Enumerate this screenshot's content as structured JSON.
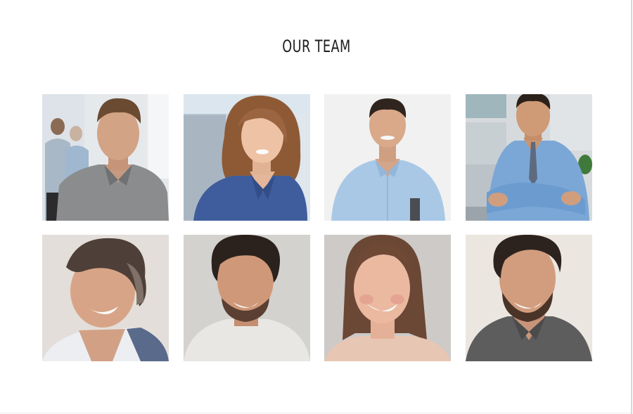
{
  "section": {
    "title": "OUR TEAM"
  },
  "team": [
    {
      "photo": "man-grey-shirt-office-photo",
      "bg": "#e7eaee"
    },
    {
      "photo": "woman-blue-blouse-photo",
      "bg": "#cfd8df"
    },
    {
      "photo": "man-light-blue-shirt-folder-photo",
      "bg": "#f2f2f2"
    },
    {
      "photo": "man-blue-shirt-tie-arms-crossed-photo",
      "bg": "#d7dbde"
    },
    {
      "photo": "man-smiling-white-collar-photo",
      "bg": "#e2ddd8"
    },
    {
      "photo": "man-curly-hair-beard-photo",
      "bg": "#d5d3d0"
    },
    {
      "photo": "woman-smiling-pink-top-photo",
      "bg": "#cfccc9"
    },
    {
      "photo": "man-beard-grey-shirt-photo",
      "bg": "#ebe6e1"
    }
  ]
}
